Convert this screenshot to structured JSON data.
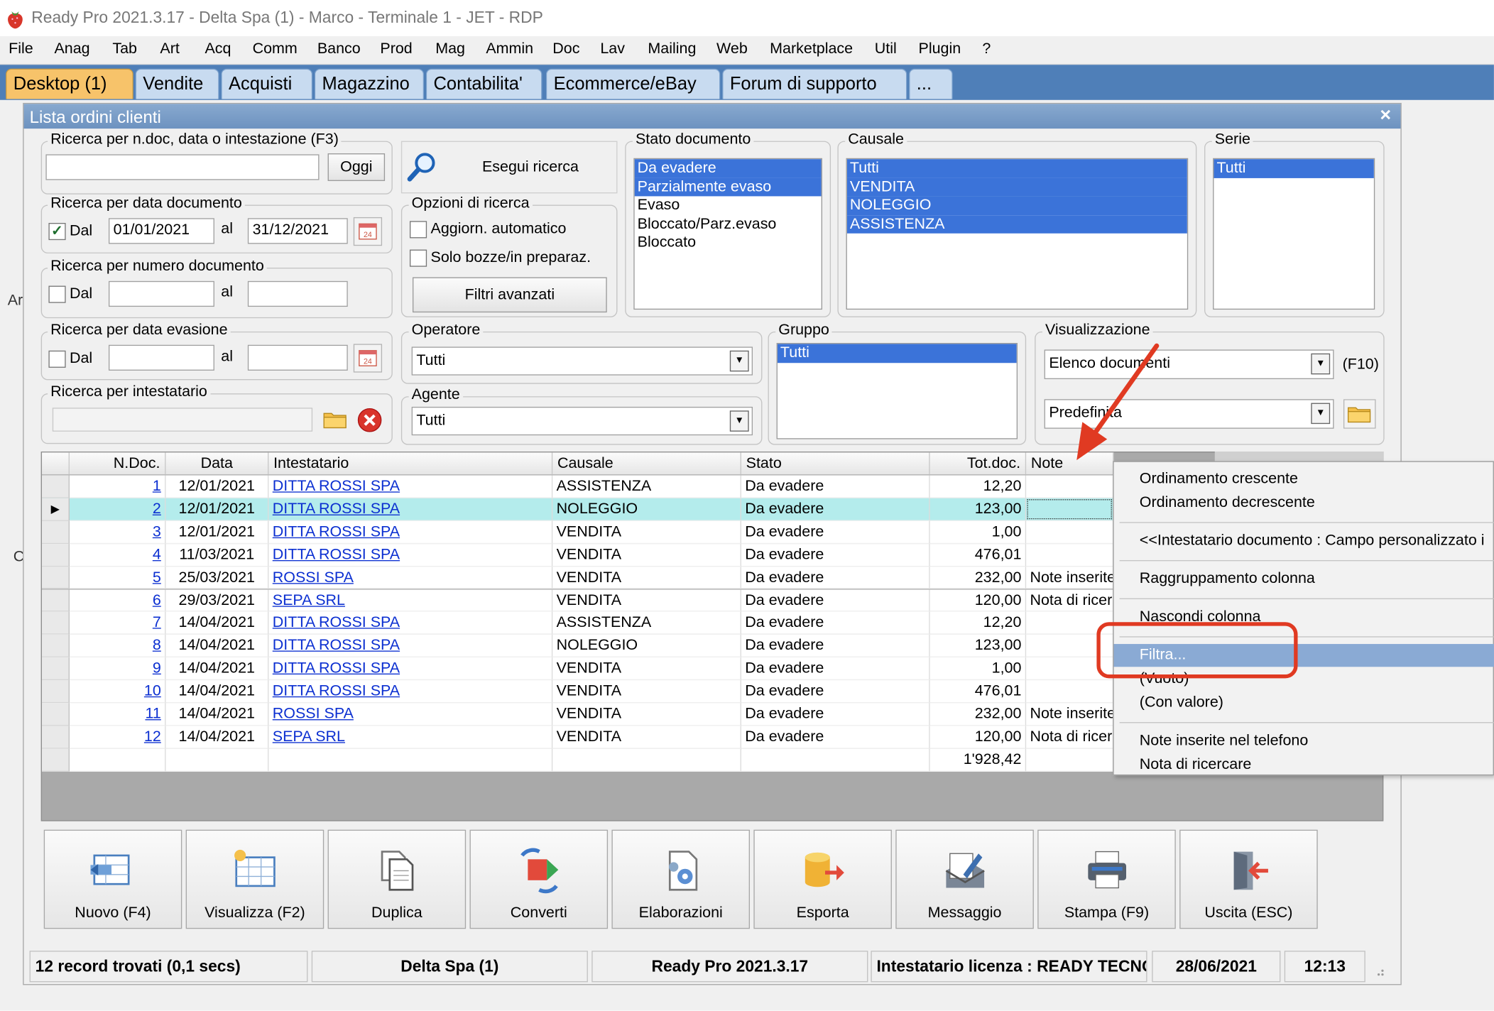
{
  "window_title": "Ready Pro 2021.3.17 - Delta Spa (1) - Marco - Terminale 1 - JET - RDP",
  "menu": [
    "File",
    "Anag",
    "Tab",
    "Art",
    "Acq",
    "Comm",
    "Banco",
    "Prod",
    "Mag",
    "Ammin",
    "Doc",
    "Lav",
    "Mailing",
    "Web",
    "Marketplace",
    "Util",
    "Plugin",
    "?"
  ],
  "tabs": [
    "Desktop (1)",
    "Vendite",
    "Acquisti",
    "Magazzino",
    "Contabilita'",
    "Ecommerce/eBay",
    "Forum di supporto",
    "..."
  ],
  "dialog": {
    "title": "Lista ordini clienti",
    "close": "×",
    "stray_left_1": "Ar",
    "stray_left_2": "C",
    "search_text": {
      "label": "Ricerca per n.doc, data o intestazione (F3)",
      "value": "",
      "today_button": "Oggi"
    },
    "run_search": "Esegui ricerca",
    "date_doc": {
      "label": "Ricerca per data documento",
      "from_label": "Dal",
      "checked": true,
      "from": "01/01/2021",
      "to_label": "al",
      "to": "31/12/2021"
    },
    "num_doc": {
      "label": "Ricerca per numero documento",
      "from_label": "Dal",
      "checked": false,
      "to_label": "al"
    },
    "date_evas": {
      "label": "Ricerca per data evasione",
      "from_label": "Dal",
      "checked": false,
      "to_label": "al"
    },
    "holder": {
      "label": "Ricerca per intestatario",
      "value": ""
    },
    "options": {
      "label": "Opzioni di ricerca",
      "auto_update": "Aggiorn. automatico",
      "drafts_only": "Solo bozze/in preparaz.",
      "advanced": "Filtri avanzati"
    },
    "operator": {
      "label": "Operatore",
      "value": "Tutti"
    },
    "agent": {
      "label": "Agente",
      "value": "Tutti"
    },
    "status_list": {
      "label": "Stato documento",
      "items": [
        {
          "text": "Da evadere",
          "selected": true
        },
        {
          "text": "Parzialmente evaso",
          "selected": true
        },
        {
          "text": "Evaso",
          "selected": false
        },
        {
          "text": "Bloccato/Parz.evaso",
          "selected": false
        },
        {
          "text": "Bloccato",
          "selected": false
        }
      ]
    },
    "cause_list": {
      "label": "Causale",
      "items": [
        {
          "text": "Tutti",
          "selected": true
        },
        {
          "text": "VENDITA",
          "selected": true
        },
        {
          "text": "NOLEGGIO",
          "selected": true
        },
        {
          "text": "ASSISTENZA",
          "selected": true
        }
      ]
    },
    "series_list": {
      "label": "Serie",
      "items": [
        {
          "text": "Tutti",
          "selected": true
        }
      ]
    },
    "group_list": {
      "label": "Gruppo",
      "items": [
        {
          "text": "Tutti",
          "selected": true
        }
      ]
    },
    "view": {
      "label": "Visualizzazione",
      "mode": "Elenco documenti",
      "hotkey": "(F10)",
      "preset": "Predefinita"
    }
  },
  "grid": {
    "columns": [
      "N.Doc.",
      "Data",
      "Intestatario",
      "Causale",
      "Stato",
      "Tot.doc.",
      "Note"
    ],
    "rows": [
      {
        "n": "1",
        "data": "12/01/2021",
        "intestatario": "DITTA ROSSI SPA",
        "causale": "ASSISTENZA",
        "stato": "Da evadere",
        "tot": "12,20",
        "note": ""
      },
      {
        "n": "2",
        "data": "12/01/2021",
        "intestatario": "DITTA ROSSI SPA",
        "causale": "NOLEGGIO",
        "stato": "Da evadere",
        "tot": "123,00",
        "note": ""
      },
      {
        "n": "3",
        "data": "12/01/2021",
        "intestatario": "DITTA ROSSI SPA",
        "causale": "VENDITA",
        "stato": "Da evadere",
        "tot": "1,00",
        "note": ""
      },
      {
        "n": "4",
        "data": "11/03/2021",
        "intestatario": "DITTA ROSSI SPA",
        "causale": "VENDITA",
        "stato": "Da evadere",
        "tot": "476,01",
        "note": ""
      },
      {
        "n": "5",
        "data": "25/03/2021",
        "intestatario": "ROSSI SPA",
        "causale": "VENDITA",
        "stato": "Da evadere",
        "tot": "232,00",
        "note": "Note inserite"
      },
      {
        "n": "6",
        "data": "29/03/2021",
        "intestatario": "SEPA SRL",
        "causale": "VENDITA",
        "stato": "Da evadere",
        "tot": "120,00",
        "note": "Nota di ricer"
      },
      {
        "n": "7",
        "data": "14/04/2021",
        "intestatario": "DITTA ROSSI SPA",
        "causale": "ASSISTENZA",
        "stato": "Da evadere",
        "tot": "12,20",
        "note": ""
      },
      {
        "n": "8",
        "data": "14/04/2021",
        "intestatario": "DITTA ROSSI SPA",
        "causale": "NOLEGGIO",
        "stato": "Da evadere",
        "tot": "123,00",
        "note": ""
      },
      {
        "n": "9",
        "data": "14/04/2021",
        "intestatario": "DITTA ROSSI SPA",
        "causale": "VENDITA",
        "stato": "Da evadere",
        "tot": "1,00",
        "note": ""
      },
      {
        "n": "10",
        "data": "14/04/2021",
        "intestatario": "DITTA ROSSI SPA",
        "causale": "VENDITA",
        "stato": "Da evadere",
        "tot": "476,01",
        "note": ""
      },
      {
        "n": "11",
        "data": "14/04/2021",
        "intestatario": "ROSSI SPA",
        "causale": "VENDITA",
        "stato": "Da evadere",
        "tot": "232,00",
        "note": "Note inserite"
      },
      {
        "n": "12",
        "data": "14/04/2021",
        "intestatario": "SEPA SRL",
        "causale": "VENDITA",
        "stato": "Da evadere",
        "tot": "120,00",
        "note": "Nota di ricer"
      }
    ],
    "total": "1'928,42",
    "current_row": 1
  },
  "context_menu": [
    {
      "text": "Ordinamento crescente"
    },
    {
      "text": "Ordinamento decrescente"
    },
    {
      "sep": true
    },
    {
      "text": "<<Intestatario documento : Campo personalizzato i"
    },
    {
      "sep": true
    },
    {
      "text": "Raggruppamento colonna"
    },
    {
      "sep": true
    },
    {
      "text": "Nascondi colonna"
    },
    {
      "sep": true
    },
    {
      "text": "Filtra...",
      "highlighted": true
    },
    {
      "text": "(Vuoto)"
    },
    {
      "text": "(Con valore)"
    },
    {
      "sep": true
    },
    {
      "text": "Note inserite nel telefono"
    },
    {
      "text": "Nota di ricercare"
    }
  ],
  "toolbar": [
    "Nuovo (F4)",
    "Visualizza (F2)",
    "Duplica",
    "Converti",
    "Elaborazioni",
    "Esporta",
    "Messaggio",
    "Stampa (F9)",
    "Uscita (ESC)"
  ],
  "statusbar": [
    "12 record trovati (0,1 secs)",
    "Delta Spa (1)",
    "Ready Pro 2021.3.17",
    "Intestatario licenza : READY TECNO",
    "28/06/2021",
    "12:13"
  ],
  "colors": {
    "tab_bar": "#4f7fb8",
    "tab_active": "#f7c36a",
    "list_selection": "#3b73d9",
    "current_row": "#b4ecec",
    "link": "#0b2fd1",
    "annotation_red": "#e03a22",
    "menu_highlight": "#8aaad4"
  }
}
